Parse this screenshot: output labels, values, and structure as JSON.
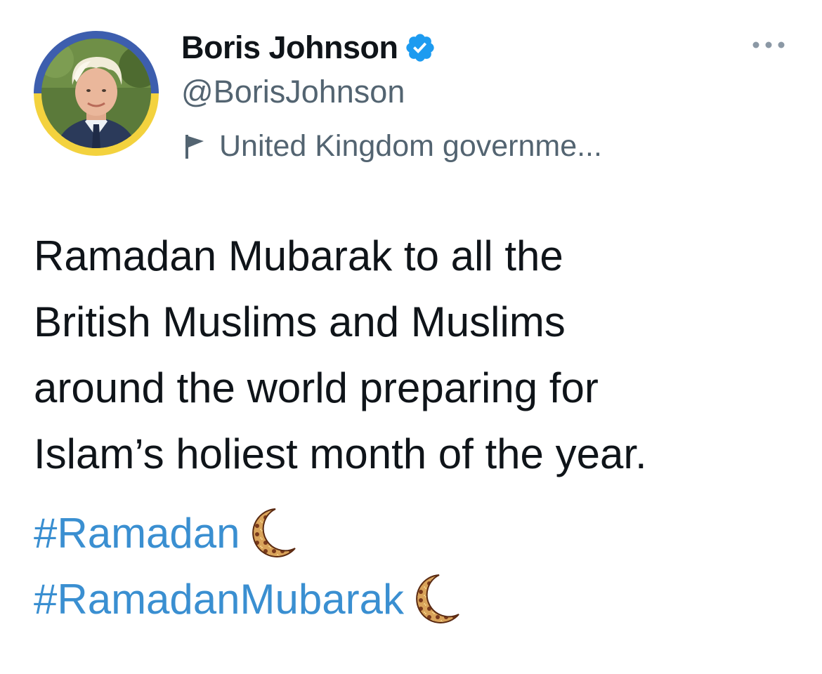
{
  "tweet": {
    "author": {
      "display_name": "Boris Johnson",
      "handle": "@BorisJohnson",
      "verified": true,
      "affiliation_label": "United Kingdom governme...",
      "avatar_ring_colors": [
        "#3d5eae",
        "#f3d23e"
      ]
    },
    "text_lines": [
      "Ramadan Mubarak to all the",
      "British Muslims and Muslims",
      "around the world preparing for",
      "Islam’s holiest month of the year."
    ],
    "hashtags": [
      {
        "text": "#Ramadan",
        "emoji": "crescent-moon-icon"
      },
      {
        "text": "#RamadanMubarak",
        "emoji": "crescent-moon-icon"
      }
    ]
  },
  "colors": {
    "text": "#0f1419",
    "secondary": "#536471",
    "link": "#3a8fd1",
    "verified": "#1d9bf0"
  },
  "icons": {
    "verified": "verified-badge-icon",
    "label": "flag-icon",
    "more": "more-options-icon"
  }
}
